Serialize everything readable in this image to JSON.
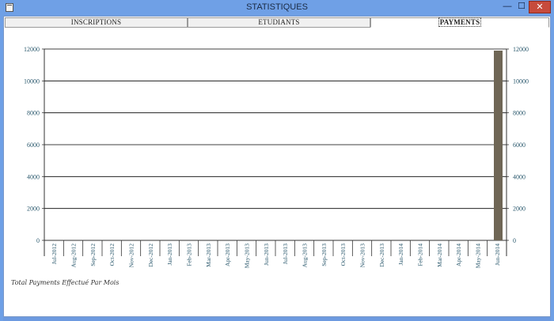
{
  "window": {
    "title": "STATISTIQUES",
    "minimize_glyph": "—",
    "maximize_glyph": "☐",
    "close_glyph": "✕"
  },
  "tabs": [
    {
      "label": "INSCRIPTIONS",
      "active": false
    },
    {
      "label": "ETUDIANTS",
      "active": false
    },
    {
      "label": "PAYMENTS",
      "active": true
    }
  ],
  "caption": "Total Payments Effectué Par Mois",
  "colors": {
    "bar": "#6f6655",
    "grid": "#000000",
    "axis_text": "#2c5a6e"
  },
  "chart_data": {
    "type": "bar",
    "title": "",
    "xlabel": "",
    "ylabel": "",
    "ylim": [
      0,
      12000
    ],
    "y_ticks": [
      0,
      2000,
      4000,
      6000,
      8000,
      10000,
      12000
    ],
    "grid": true,
    "categories": [
      "Jul-2012",
      "Aug-2012",
      "Sep-2012",
      "Oct-2012",
      "Nov-2012",
      "Dec-2012",
      "Jan-2013",
      "Feb-2013",
      "Mar-2013",
      "Apr-2013",
      "May-2013",
      "Jun-2013",
      "Jul-2013",
      "Aug-2013",
      "Sep-2013",
      "Oct-2013",
      "Nov-2013",
      "Dec-2013",
      "Jan-2014",
      "Feb-2014",
      "Mar-2014",
      "Apr-2014",
      "May-2014",
      "Jun-2014"
    ],
    "values": [
      0,
      0,
      0,
      0,
      0,
      0,
      0,
      0,
      0,
      0,
      0,
      0,
      0,
      0,
      0,
      0,
      0,
      0,
      0,
      0,
      0,
      0,
      0,
      11900
    ]
  }
}
